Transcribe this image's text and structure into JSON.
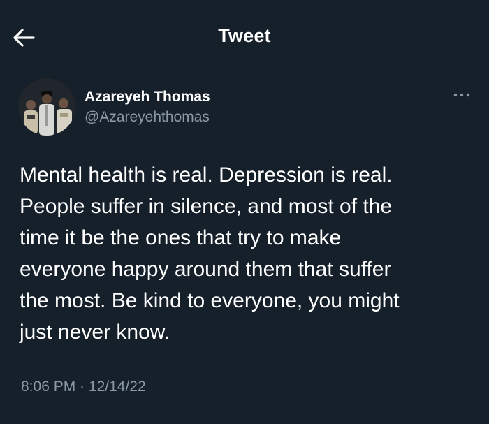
{
  "header": {
    "title": "Tweet",
    "back_icon": "arrow-left-icon"
  },
  "tweet": {
    "author": {
      "name": "Azareyeh Thomas",
      "handle": "@Azareyehthomas",
      "avatar_icon": "profile-photo"
    },
    "more_icon": "more-dots-icon",
    "text": "Mental health is real. Depression is real.\nPeople suffer in silence, and most of the\ntime it be the ones that try to make\neveryone happy around them that suffer\nthe most. Be kind to everyone, you might\njust never know.",
    "time": "8:06 PM",
    "separator": "·",
    "date": "12/14/22"
  },
  "colors": {
    "background": "#15202b",
    "text_primary": "#ffffff",
    "text_secondary": "#8b98a5",
    "divider": "#38444d"
  }
}
